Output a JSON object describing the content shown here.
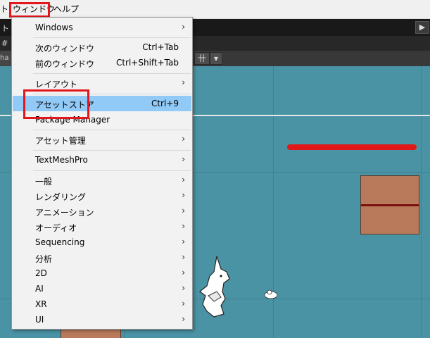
{
  "menubar": {
    "left_fragment": "ト",
    "window": "ウィンドウ",
    "help": "ヘルプ"
  },
  "toolbar": {
    "left_fragment": "ト",
    "play_symbol": "▶"
  },
  "toolbar2": {
    "left_fragment": "#"
  },
  "toolbar3": {
    "left_fragment": "ha",
    "gizmo_symbol": "卄",
    "dropdown_symbol": "▾"
  },
  "window_menu": {
    "items": [
      {
        "label": "Windows",
        "shortcut": "",
        "submenu": true
      },
      {
        "label": "次のウィンドウ",
        "shortcut": "Ctrl+Tab",
        "submenu": false
      },
      {
        "label": "前のウィンドウ",
        "shortcut": "Ctrl+Shift+Tab",
        "submenu": false
      },
      {
        "label": "レイアウト",
        "shortcut": "",
        "submenu": true
      },
      {
        "label": "アセットストア",
        "shortcut": "Ctrl+9",
        "submenu": false,
        "highlighted": true
      },
      {
        "label": "Package Manager",
        "shortcut": "",
        "submenu": false
      },
      {
        "label": "アセット管理",
        "shortcut": "",
        "submenu": true
      },
      {
        "label": "TextMeshPro",
        "shortcut": "",
        "submenu": true
      },
      {
        "label": "一般",
        "shortcut": "",
        "submenu": true
      },
      {
        "label": "レンダリング",
        "shortcut": "",
        "submenu": true
      },
      {
        "label": "アニメーション",
        "shortcut": "",
        "submenu": true
      },
      {
        "label": "オーディオ",
        "shortcut": "",
        "submenu": true
      },
      {
        "label": "Sequencing",
        "shortcut": "",
        "submenu": true
      },
      {
        "label": "分析",
        "shortcut": "",
        "submenu": true
      },
      {
        "label": "2D",
        "shortcut": "",
        "submenu": true
      },
      {
        "label": "AI",
        "shortcut": "",
        "submenu": true
      },
      {
        "label": "XR",
        "shortcut": "",
        "submenu": true
      },
      {
        "label": "UI",
        "shortcut": "",
        "submenu": true
      }
    ],
    "submenu_arrow": "›"
  },
  "colors": {
    "highlight": "#91c9f7",
    "annotation_red": "#e3161b",
    "scene_bg": "#4a93a4"
  }
}
